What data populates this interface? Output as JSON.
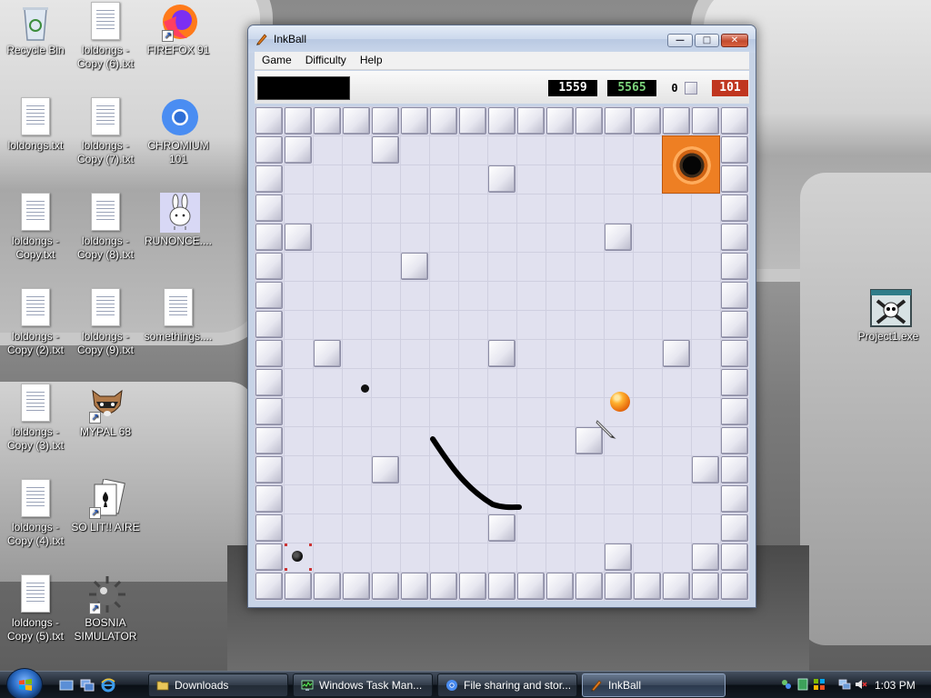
{
  "desktop": {
    "icons": [
      {
        "label": "Recycle Bin",
        "kind": "recycle-bin"
      },
      {
        "label": "loldongs - Copy (6).txt",
        "kind": "text-file"
      },
      {
        "label": "FIREFOX 91",
        "kind": "firefox-shortcut"
      },
      {
        "label": "loldongs.txt",
        "kind": "text-file"
      },
      {
        "label": "loldongs - Copy (7).txt",
        "kind": "text-file"
      },
      {
        "label": "CHROMIUM 101",
        "kind": "chromium-shortcut"
      },
      {
        "label": "loldongs - Copy.txt",
        "kind": "text-file"
      },
      {
        "label": "loldongs - Copy (8).txt",
        "kind": "text-file"
      },
      {
        "label": "RUNONCE....",
        "kind": "bunny-app"
      },
      {
        "label": "loldongs - Copy (2).txt",
        "kind": "text-file"
      },
      {
        "label": "loldongs - Copy (9).txt",
        "kind": "text-file"
      },
      {
        "label": "somethings....",
        "kind": "text-file"
      },
      {
        "label": "loldongs - Copy (3).txt",
        "kind": "text-file"
      },
      {
        "label": "MYPAL 68",
        "kind": "raccoon-shortcut"
      },
      {
        "label": "loldongs - Copy (4).txt",
        "kind": "text-file"
      },
      {
        "label": "SO LIT!! AIRE",
        "kind": "solitaire-shortcut"
      },
      {
        "label": "loldongs - Copy (5).txt",
        "kind": "text-file"
      },
      {
        "label": "BOSNIA SIMULATOR",
        "kind": "mine-shortcut"
      },
      {
        "label": "Project1.exe",
        "kind": "skull-exe"
      }
    ]
  },
  "window": {
    "title": "InkBall",
    "buttons": {
      "minimize": "—",
      "maximize": "□",
      "close": "✕"
    },
    "menu": [
      "Game",
      "Difficulty",
      "Help"
    ]
  },
  "scorebar": {
    "score": "1559",
    "high_score": "5565",
    "balls_captured": "0",
    "time": "101"
  },
  "board": {
    "grid_size": 17,
    "accent_colors": {
      "orange": "#ee7f23",
      "board": "#e1e1ef",
      "red_counter": "#c03620",
      "green_counter": "#7bd37b"
    }
  },
  "taskbar": {
    "buttons": [
      {
        "label": "Downloads",
        "icon": "folder-icon"
      },
      {
        "label": "Windows Task Man...",
        "icon": "task-manager-icon"
      },
      {
        "label": "File sharing and stor...",
        "icon": "chromium-icon"
      },
      {
        "label": "InkBall",
        "icon": "inkball-icon"
      }
    ],
    "clock": "1:03 PM"
  }
}
